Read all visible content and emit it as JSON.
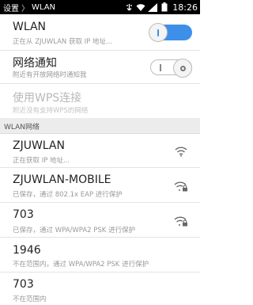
{
  "statusbar": {
    "back_label": "设置",
    "separator": "〉",
    "page_label": "WLAN",
    "time": "18:26",
    "icons": [
      "usb-icon",
      "wifi-icon",
      "signal-icon",
      "battery-icon"
    ]
  },
  "settings": {
    "wlan": {
      "title": "WLAN",
      "subtitle": "正在从 ZJUWLAN 获取 IP 地址...",
      "enabled": true
    },
    "notify": {
      "title": "网络通知",
      "subtitle": "附近有开放网络时通知我",
      "enabled": false
    },
    "wps": {
      "title": "使用WPS连接",
      "subtitle": "附近没有支持WPS的网络"
    }
  },
  "section_header": "WLAN网络",
  "networks": [
    {
      "ssid": "ZJUWLAN",
      "status": "正在获取 IP 地址...",
      "icon": "wifi-open-icon"
    },
    {
      "ssid": "ZJUWLAN-MOBILE",
      "status": "已保存，通过 802.1x EAP 进行保护",
      "icon": "wifi-lock-icon"
    },
    {
      "ssid": "703",
      "status": "已保存，通过 WPA/WPA2 PSK 进行保护",
      "icon": "wifi-lock-icon"
    },
    {
      "ssid": "1946",
      "status": "不在范围内，通过 WPA/WPA2 PSK 进行保护",
      "icon": "none"
    },
    {
      "ssid": "703",
      "status": "不在范围内",
      "icon": "none"
    }
  ],
  "colors": {
    "accent": "#3d8fe8",
    "statusbar": "#000000",
    "section": "#ececec"
  }
}
